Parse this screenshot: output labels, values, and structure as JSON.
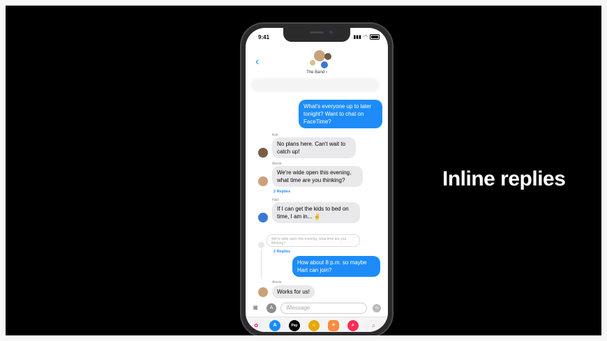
{
  "slide": {
    "headline": "Inline replies"
  },
  "status_bar": {
    "time": "9:41"
  },
  "conversation": {
    "group_name": "The Band"
  },
  "messages": [
    {
      "type": "outgoing",
      "text": "What's everyone up to later tonight? Want to chat on FaceTime?"
    },
    {
      "type": "incoming",
      "sender": "Kirk",
      "text": "No plans here. Can't wait to catch up!"
    },
    {
      "type": "incoming",
      "sender": "Alexis",
      "text": "We're wide open this evening, what time are you thinking?",
      "replies": "2 Replies"
    },
    {
      "type": "incoming",
      "sender": "Hart",
      "text": "If I can get the kids to bed on time, I am in... ✌️"
    }
  ],
  "thread": {
    "quoted_text": "We're wide open this evening, what time are you thinking?",
    "replies": "2 Replies",
    "reply_out": "How about 8 p.m. so maybe Hart can join?",
    "reply_in_sender": "Alexis",
    "reply_in": "Works for us!"
  },
  "compose": {
    "placeholder": "iMessage"
  },
  "app_tray": [
    {
      "name": "photos-app-icon",
      "color": "#ffffff"
    },
    {
      "name": "app-store-icon",
      "color": "#1a8cff"
    },
    {
      "name": "apple-pay-icon",
      "label": "Pay",
      "color": "#000000"
    },
    {
      "name": "memoji-icon",
      "color": "#e6a800"
    },
    {
      "name": "stickers-icon",
      "color": "#ff8a3d"
    },
    {
      "name": "search-images-icon",
      "color": "#ff2d55"
    },
    {
      "name": "music-icon",
      "color": "#ffffff"
    }
  ]
}
